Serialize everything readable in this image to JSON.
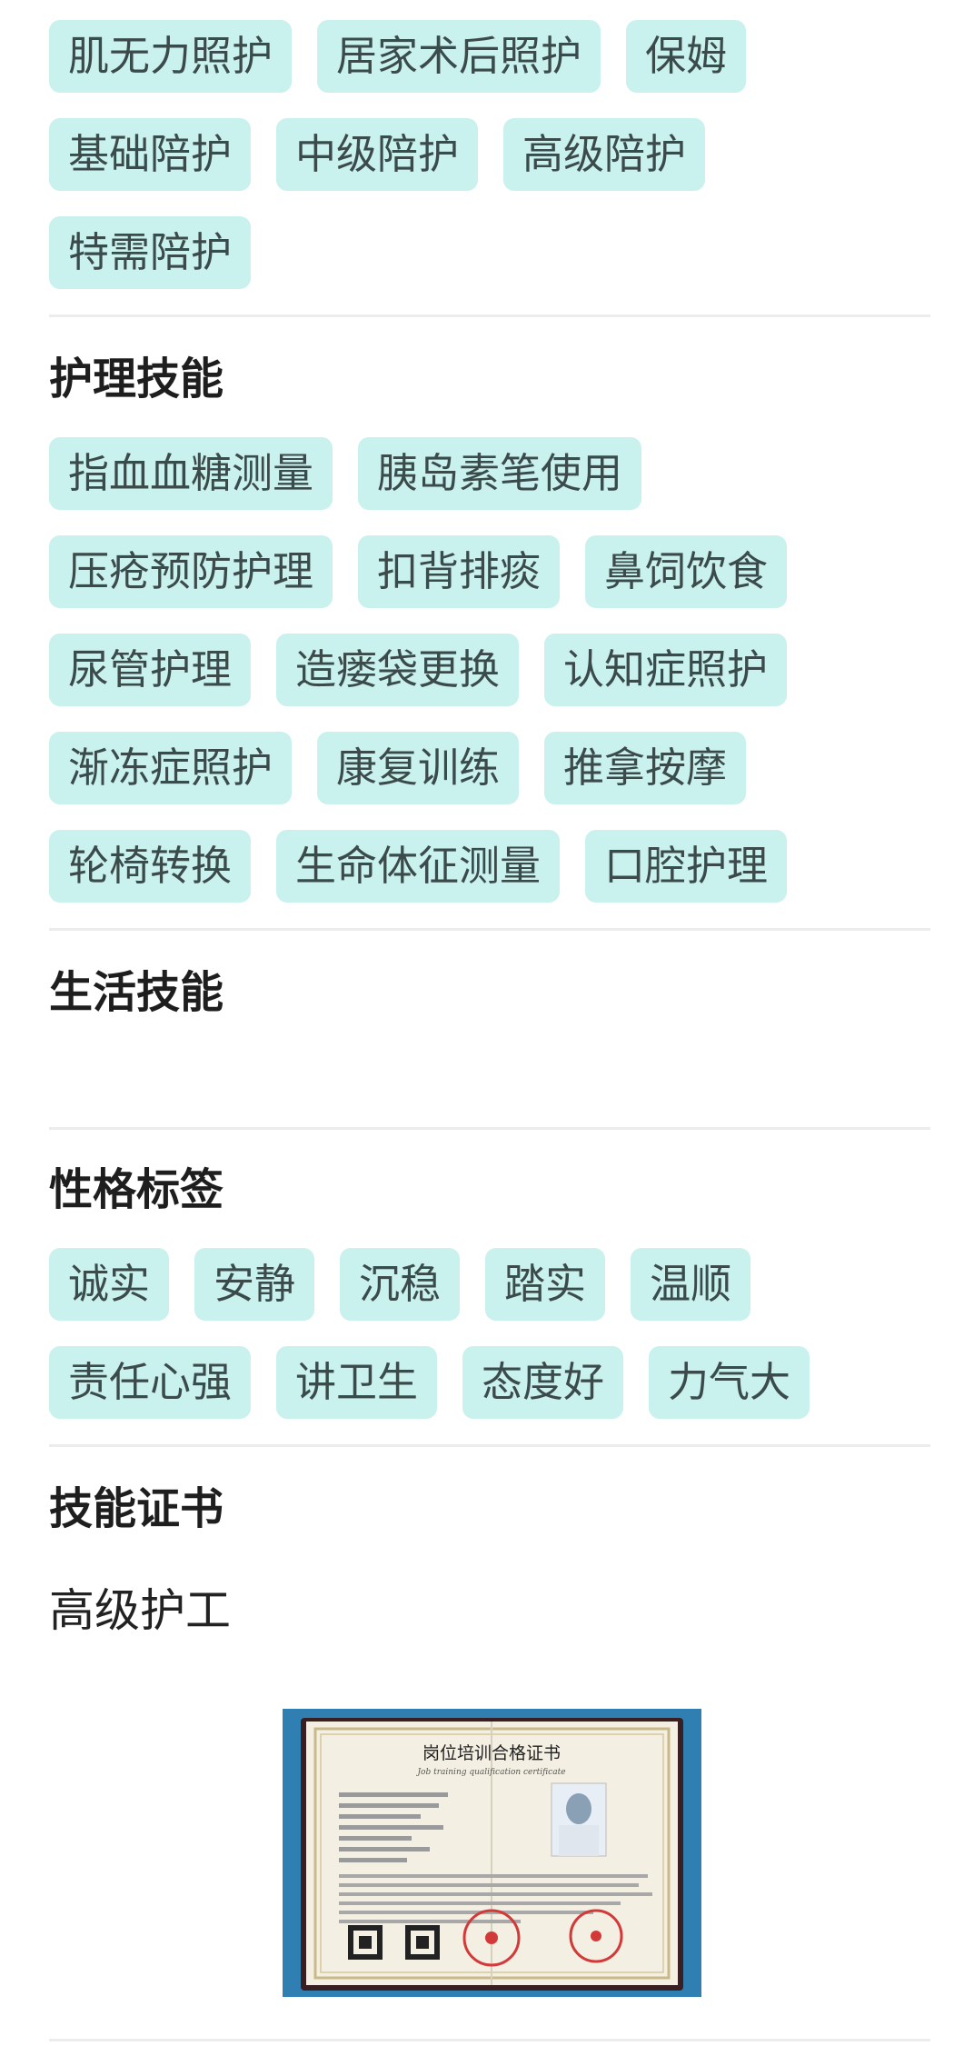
{
  "service_types": {
    "rows": [
      [
        "肌无力照护",
        "居家术后照护",
        "保姆"
      ],
      [
        "基础陪护",
        "中级陪护",
        "高级陪护"
      ],
      [
        "特需陪护"
      ]
    ]
  },
  "nursing_skills": {
    "title": "护理技能",
    "rows": [
      [
        "指血血糖测量",
        "胰岛素笔使用"
      ],
      [
        "压疮预防护理",
        "扣背排痰",
        "鼻饲饮食"
      ],
      [
        "尿管护理",
        "造瘘袋更换",
        "认知症照护"
      ],
      [
        "渐冻症照护",
        "康复训练",
        "推拿按摩"
      ],
      [
        "轮椅转换",
        "生命体征测量",
        "口腔护理"
      ]
    ]
  },
  "life_skills": {
    "title": "生活技能"
  },
  "character_tags": {
    "title": "性格标签",
    "rows": [
      [
        "诚实",
        "安静",
        "沉稳",
        "踏实",
        "温顺"
      ],
      [
        "责任心强",
        "讲卫生",
        "态度好",
        "力气大"
      ]
    ]
  },
  "certificate": {
    "title": "技能证书",
    "name": "高级护工",
    "card": {
      "heading": "岗位培训合格证书",
      "subheading": "Job training qualification certificate"
    }
  },
  "colors": {
    "tag_bg": "#c9f1ed",
    "tag_text": "#3b4a4a",
    "divider": "#ececec",
    "cert_bg": "#2f7fb2"
  }
}
